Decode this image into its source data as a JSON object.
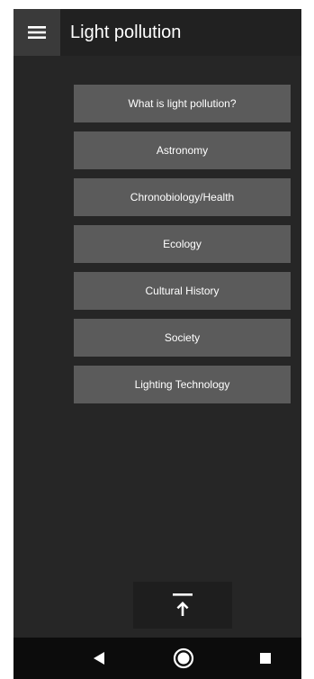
{
  "header": {
    "menu_icon": "hamburger-menu-icon",
    "title": "Light pollution"
  },
  "menu": {
    "items": [
      {
        "label": "What is light pollution?"
      },
      {
        "label": "Astronomy"
      },
      {
        "label": "Chronobiology/Health"
      },
      {
        "label": "Ecology"
      },
      {
        "label": "Cultural History"
      },
      {
        "label": "Society"
      },
      {
        "label": "Lighting Technology"
      }
    ]
  },
  "scroll_top": {
    "icon": "arrow-up-to-top-icon"
  },
  "navbar": {
    "back_icon": "back-triangle-icon",
    "home_icon": "home-circle-icon",
    "recents_icon": "recents-square-icon"
  },
  "colors": {
    "background": "#262626",
    "appbar": "#212121",
    "button": "#5b5b5b",
    "text": "#ffffff",
    "navbar": "#0c0c0c"
  }
}
